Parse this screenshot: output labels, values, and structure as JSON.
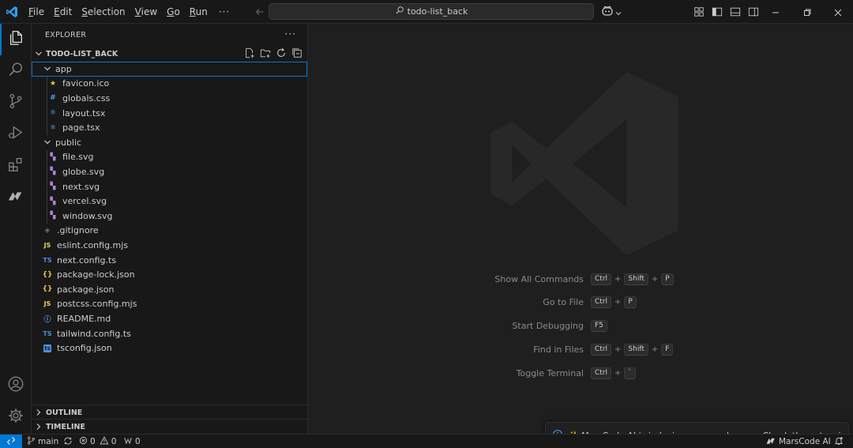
{
  "titlebar": {
    "menu": [
      {
        "mnemonic": "F",
        "rest": "ile"
      },
      {
        "mnemonic": "E",
        "rest": "dit"
      },
      {
        "mnemonic": "S",
        "rest": "election"
      },
      {
        "mnemonic": "V",
        "rest": "iew"
      },
      {
        "mnemonic": "G",
        "rest": "o"
      },
      {
        "mnemonic": "R",
        "rest": "un"
      }
    ],
    "more": "···",
    "search_text": "todo-list_back"
  },
  "sidebar": {
    "title": "EXPLORER",
    "more": "···",
    "root": "TODO-LIST_BACK",
    "tree": [
      {
        "name": "app",
        "type": "folder",
        "depth": 0
      },
      {
        "name": "favicon.ico",
        "type": "file",
        "depth": 1,
        "icon": "star-icon",
        "icon_text": "★",
        "color": "#e8c34a"
      },
      {
        "name": "globals.css",
        "type": "file",
        "depth": 1,
        "icon": "css-hash-icon",
        "icon_text": "#",
        "color": "#42a5f5"
      },
      {
        "name": "layout.tsx",
        "type": "file",
        "depth": 1,
        "icon": "react-icon",
        "icon_text": "⚛",
        "color": "#4fc3f7"
      },
      {
        "name": "page.tsx",
        "type": "file",
        "depth": 1,
        "icon": "react-icon",
        "icon_text": "⚛",
        "color": "#4fc3f7"
      },
      {
        "name": "public",
        "type": "folder",
        "depth": 0
      },
      {
        "name": "file.svg",
        "type": "file",
        "depth": 1,
        "icon": "svg-icon",
        "icon_text": "▚",
        "color": "#b57fdf"
      },
      {
        "name": "globe.svg",
        "type": "file",
        "depth": 1,
        "icon": "svg-icon",
        "icon_text": "▚",
        "color": "#b57fdf"
      },
      {
        "name": "next.svg",
        "type": "file",
        "depth": 1,
        "icon": "svg-icon",
        "icon_text": "▚",
        "color": "#b57fdf"
      },
      {
        "name": "vercel.svg",
        "type": "file",
        "depth": 1,
        "icon": "svg-icon",
        "icon_text": "▚",
        "color": "#b57fdf"
      },
      {
        "name": "window.svg",
        "type": "file",
        "depth": 1,
        "icon": "svg-icon",
        "icon_text": "▚",
        "color": "#b57fdf"
      },
      {
        "name": ".gitignore",
        "type": "file",
        "depth": 0,
        "icon": "git-icon",
        "icon_text": "◈",
        "color": "#6d6d6d"
      },
      {
        "name": "eslint.config.mjs",
        "type": "file",
        "depth": 0,
        "icon": "js-icon",
        "icon_text": "JS",
        "color": "#e8d44d"
      },
      {
        "name": "next.config.ts",
        "type": "file",
        "depth": 0,
        "icon": "ts-icon",
        "icon_text": "TS",
        "color": "#4a90d9"
      },
      {
        "name": "package-lock.json",
        "type": "file",
        "depth": 0,
        "icon": "json-icon",
        "icon_text": "{}",
        "color": "#e8c34a"
      },
      {
        "name": "package.json",
        "type": "file",
        "depth": 0,
        "icon": "json-icon",
        "icon_text": "{}",
        "color": "#e8c34a"
      },
      {
        "name": "postcss.config.mjs",
        "type": "file",
        "depth": 0,
        "icon": "js-icon",
        "icon_text": "JS",
        "color": "#e8d44d"
      },
      {
        "name": "README.md",
        "type": "file",
        "depth": 0,
        "icon": "info-icon",
        "icon_text": "ⓘ",
        "color": "#6aa5e8"
      },
      {
        "name": "tailwind.config.ts",
        "type": "file",
        "depth": 0,
        "icon": "ts-icon",
        "icon_text": "TS",
        "color": "#4a90d9"
      },
      {
        "name": "tsconfig.json",
        "type": "file",
        "depth": 0,
        "icon": "tsconfig-icon",
        "icon_text": "ts",
        "color": "#4a90d9"
      }
    ],
    "outline": "OUTLINE",
    "timeline": "TIMELINE"
  },
  "editor": {
    "shortcuts": [
      {
        "label": "Show All Commands",
        "keys": [
          "Ctrl",
          "Shift",
          "P"
        ]
      },
      {
        "label": "Go to File",
        "keys": [
          "Ctrl",
          "P"
        ]
      },
      {
        "label": "Start Debugging",
        "keys": [
          "F5"
        ]
      },
      {
        "label": "Find in Files",
        "keys": [
          "Ctrl",
          "Shift",
          "F"
        ]
      },
      {
        "label": "Toggle Terminal",
        "keys": [
          "Ctrl",
          "`"
        ]
      }
    ]
  },
  "notification": {
    "text": "✨ MarsCode AI is indexing your workspace. Check the extension setti..."
  },
  "statusbar": {
    "branch": "main",
    "errors": "0",
    "warnings": "0",
    "ports": "0",
    "marscode": "MarsCode AI"
  },
  "colors": {
    "accent": "#0078d4",
    "background": "#1f1f1f",
    "chrome": "#181818"
  }
}
